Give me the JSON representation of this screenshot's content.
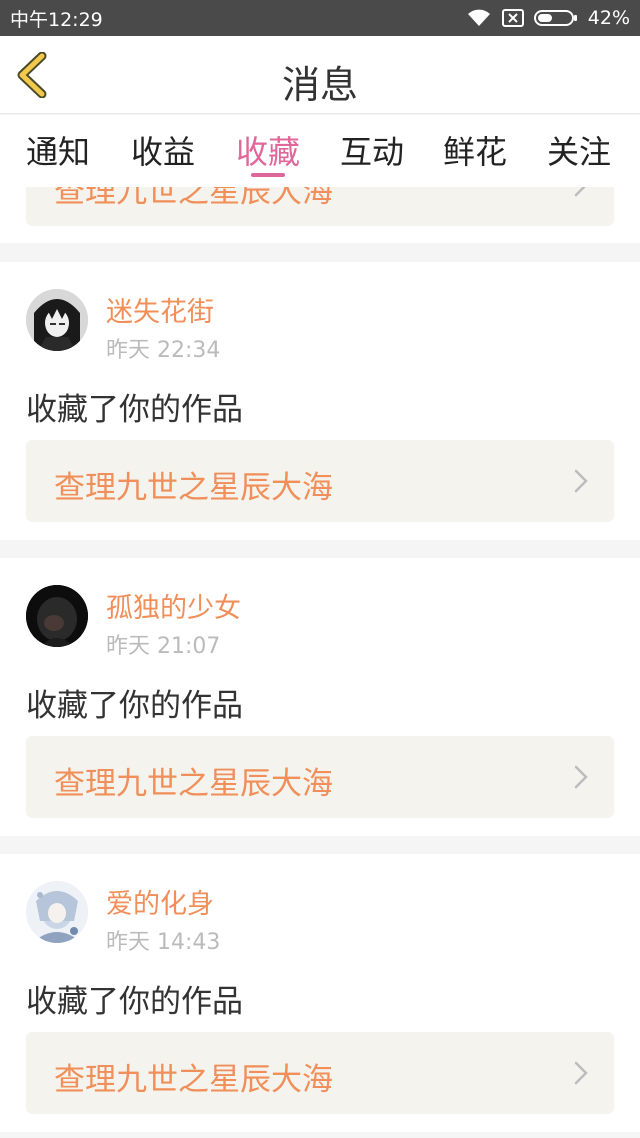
{
  "status_bar": {
    "time": "中午12:29",
    "battery": "42%",
    "icons": [
      "wifi-icon",
      "sim-off-icon",
      "battery-icon"
    ]
  },
  "header": {
    "title": "消息",
    "back_icon": "back-chevron-icon"
  },
  "tabs": [
    {
      "label": "通知",
      "active": false
    },
    {
      "label": "收益",
      "active": false
    },
    {
      "label": "收藏",
      "active": true
    },
    {
      "label": "互动",
      "active": false
    },
    {
      "label": "鲜花",
      "active": false
    },
    {
      "label": "关注",
      "active": false
    }
  ],
  "partial_card": {
    "work_title": "查理九世之星辰大海"
  },
  "messages": [
    {
      "username": "迷失花街",
      "time": "昨天 22:34",
      "action": "收藏了你的作品",
      "work_title": "查理九世之星辰大海",
      "avatar_icon": "anime-boy-avatar"
    },
    {
      "username": "孤独的少女",
      "time": "昨天 21:07",
      "action": "收藏了你的作品",
      "work_title": "查理九世之星辰大海",
      "avatar_icon": "dark-girl-avatar"
    },
    {
      "username": "爱的化身",
      "time": "昨天 14:43",
      "action": "收藏了你的作品",
      "work_title": "查理九世之星辰大海",
      "avatar_icon": "pale-anime-avatar"
    }
  ],
  "colors": {
    "accent": "#e0679b",
    "username": "#f08f5a",
    "back_icon": "#f2c94c",
    "work_box_bg": "#f4f3ee"
  }
}
